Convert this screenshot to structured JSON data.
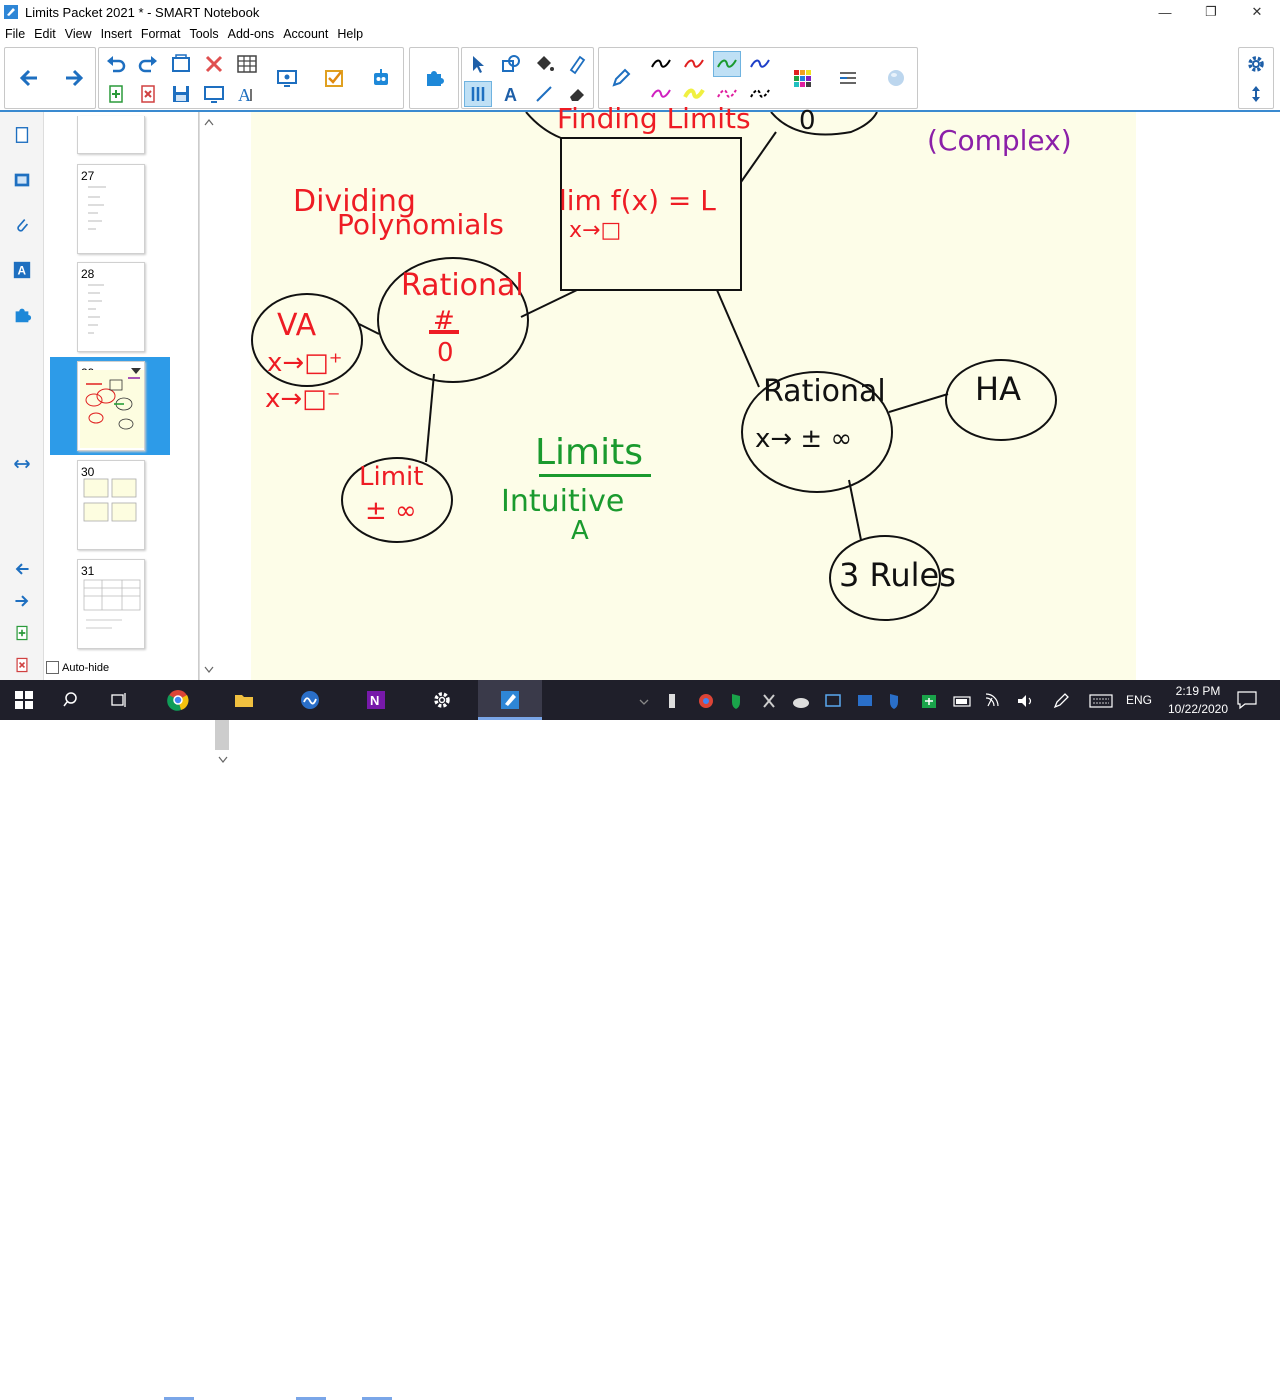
{
  "window": {
    "title": "Limits Packet 2021 * - SMART Notebook",
    "min": "—",
    "max": "❐",
    "close": "✕"
  },
  "menu": [
    "File",
    "Edit",
    "View",
    "Insert",
    "Format",
    "Tools",
    "Add-ons",
    "Account",
    "Help"
  ],
  "page_sorter": {
    "pages": [
      {
        "num": "27"
      },
      {
        "num": "28"
      },
      {
        "num": "29",
        "selected": true
      },
      {
        "num": "30"
      },
      {
        "num": "31"
      }
    ],
    "autohide_label": "Auto-hide"
  },
  "canvas": {
    "text": {
      "finding_limits": "Finding Limits",
      "complex": "(Complex)",
      "dividing": "Dividing",
      "polynomials": "Polynomials",
      "lim_fx": "lim f(x) = L",
      "x_to_box": "x→□",
      "rational1": "Rational",
      "frac_num": "#",
      "frac_den": "0",
      "va": "VA",
      "va_x1": "x→□⁺",
      "va_x2": "x→□⁻",
      "limit_pm": "Limit",
      "pm_inf": "± ∞",
      "limits": "Limits",
      "intuitive": "Intuitive",
      "a_mark": "A",
      "rational2": "Rational",
      "x_pm_inf": "x→ ± ∞",
      "ha": "HA",
      "three_rules": "3 Rules",
      "top_zero": "0"
    },
    "colors": {
      "red": "#ee1c24",
      "black": "#111111",
      "green": "#1a9a2e",
      "purple": "#8b1fa8"
    }
  },
  "taskbar": {
    "lang": "ENG",
    "time": "2:19 PM",
    "date": "10/22/2020"
  }
}
